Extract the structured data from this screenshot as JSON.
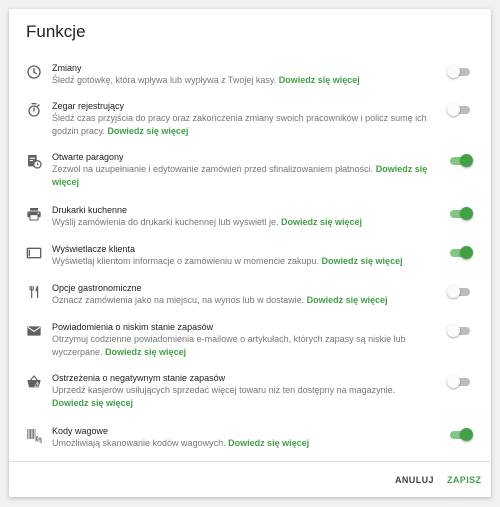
{
  "dialog": {
    "title": "Funkcje",
    "cancel_label": "ANULUJ",
    "save_label": "ZAPISZ"
  },
  "colors": {
    "accent": "#43a047",
    "toggle_off": "#bdbdbd"
  },
  "features": [
    {
      "icon": "clock-icon",
      "title": "Zmiany",
      "description": "Śledź gotówkę, która wpływa lub wypływa z Twojej kasy.",
      "link": "Dowiedz się więcej",
      "enabled": false
    },
    {
      "icon": "stopwatch-icon",
      "title": "Zegar rejestrujący",
      "description": "Śledź czas przyjścia do pracy oraz zakończenia zmiany swoich pracowników i policz sumę ich godzin pracy.",
      "link": "Dowiedz się więcej",
      "enabled": false
    },
    {
      "icon": "receipt-clock-icon",
      "title": "Otwarte paragony",
      "description": "Zezwól na uzupełnianie i edytowanie zamówień przed sfinalizowaniem płatności.",
      "link": "Dowiedz się więcej",
      "enabled": true
    },
    {
      "icon": "printer-icon",
      "title": "Drukarki kuchenne",
      "description": "Wyślij zamówienia do drukarki kuchennej lub wyświetl je.",
      "link": "Dowiedz się więcej",
      "enabled": true
    },
    {
      "icon": "monitor-icon",
      "title": "Wyświetlacze klienta",
      "description": "Wyświetlaj klientom informacje o zamówieniu w momencie zakupu.",
      "link": "Dowiedz się więcej",
      "enabled": true
    },
    {
      "icon": "cutlery-icon",
      "title": "Opcje gastronomiczne",
      "description": "Oznacz zamówienia jako na miejscu, na wynos lub w dostawie.",
      "link": "Dowiedz się więcej",
      "enabled": false
    },
    {
      "icon": "envelope-icon",
      "title": "Powiadomienia o niskim stanie zapasów",
      "description": "Otrzymuj codzienne powiadomienia e-mailowe o artykułach, których zapasy są niskie lub wyczerpane.",
      "link": "Dowiedz się więcej",
      "enabled": false
    },
    {
      "icon": "basket-warning-icon",
      "title": "Ostrzeżenia o negatywnym stanie zapasów",
      "description": "Uprzedź kasjerów usiłujących sprzedać więcej towaru niż ten dostępny na magazynie.",
      "link": "Dowiedz się więcej",
      "enabled": false
    },
    {
      "icon": "barcode-kg-icon",
      "title": "Kody wagowe",
      "description": "Umożliwiają skanowanie kodów wagowych.",
      "link": "Dowiedz się więcej",
      "enabled": true
    }
  ]
}
